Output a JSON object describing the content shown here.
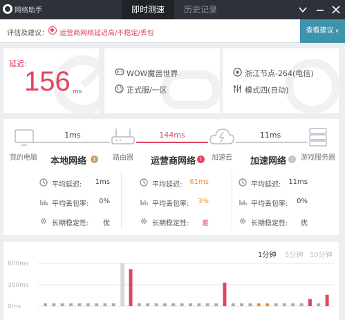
{
  "titlebar": {
    "app_title": "网络助手",
    "tabs": [
      {
        "label": "即时测速",
        "active": true
      },
      {
        "label": "历史记录",
        "active": false
      }
    ],
    "controls": [
      "chevron-down-icon",
      "minimize-icon",
      "close-icon"
    ]
  },
  "advice": {
    "label": "评估及建议：",
    "text": "运营商网络延迟高/不稳定/丢包",
    "button_label": "查看建议",
    "status_color": "#e0465f"
  },
  "latency_card": {
    "label": "延迟:",
    "value": "156",
    "unit": "ms"
  },
  "game_card": {
    "game_name": "WOW魔兽世界",
    "server": "正式服/一区"
  },
  "node_card": {
    "node": "浙江节点-264(电信)",
    "mode": "模式四(自动)"
  },
  "route": {
    "nodes": [
      {
        "label": "我的电脑",
        "icon": "computer-icon"
      },
      {
        "label": "路由器",
        "icon": "router-icon"
      },
      {
        "label": "加速云",
        "icon": "cloud-icon"
      },
      {
        "label": "游戏服务器",
        "icon": "server-icon"
      }
    ],
    "hops": [
      {
        "latency": "1ms",
        "status": "good"
      },
      {
        "latency": "144ms",
        "status": "bad"
      },
      {
        "latency": "11ms",
        "status": "good"
      }
    ],
    "sections": [
      {
        "title": "本地网络",
        "badge_icon": "info-icon",
        "stats": [
          {
            "label": "平均延迟:",
            "value": "1ms",
            "status": "normal"
          },
          {
            "label": "平均丢包率:",
            "value": "0%",
            "status": "normal"
          },
          {
            "label": "长期稳定性:",
            "value": "优",
            "status": "normal"
          }
        ]
      },
      {
        "title": "运营商网络",
        "badge_icon": "alert-icon",
        "stats": [
          {
            "label": "平均延迟:",
            "value": "61ms",
            "status": "warn"
          },
          {
            "label": "平均丢包率:",
            "value": "3%",
            "status": "warn"
          },
          {
            "label": "长期稳定性:",
            "value": "差",
            "status": "bad"
          }
        ]
      },
      {
        "title": "加速网络",
        "badge_icon": "info-icon",
        "stats": [
          {
            "label": "平均延迟:",
            "value": "11ms",
            "status": "normal"
          },
          {
            "label": "平均丢包率:",
            "value": "0%",
            "status": "normal"
          },
          {
            "label": "长期稳定性:",
            "value": "优",
            "status": "normal"
          }
        ]
      }
    ],
    "colors": {
      "good": "#c6cbd2",
      "bad": "#e0465f",
      "warn": "#f08c2e",
      "normal": "#444444"
    }
  },
  "chart": {
    "ranges": [
      {
        "label": "1分钟",
        "active": true
      },
      {
        "label": "5分钟",
        "active": false
      },
      {
        "label": "10分钟",
        "active": false
      }
    ]
  },
  "chart_data": {
    "type": "bar",
    "ylabel": "",
    "y_ticks": [
      "600ms",
      "300ms",
      "0ms"
    ],
    "ylim": [
      0,
      600
    ],
    "grid": true,
    "bars": [
      {
        "value": 40,
        "status": "normal"
      },
      {
        "value": 40,
        "status": "normal"
      },
      {
        "value": 40,
        "status": "normal"
      },
      {
        "value": 40,
        "status": "normal"
      },
      {
        "value": 40,
        "status": "normal"
      },
      {
        "value": 40,
        "status": "normal"
      },
      {
        "value": 40,
        "status": "normal"
      },
      {
        "value": 40,
        "status": "normal"
      },
      {
        "value": 40,
        "status": "normal"
      },
      {
        "value": 600,
        "status": "loss"
      },
      {
        "value": 520,
        "status": "high"
      },
      {
        "value": 40,
        "status": "normal"
      },
      {
        "value": 40,
        "status": "normal"
      },
      {
        "value": 40,
        "status": "normal"
      },
      {
        "value": 40,
        "status": "normal"
      },
      {
        "value": 40,
        "status": "normal"
      },
      {
        "value": 40,
        "status": "normal"
      },
      {
        "value": 40,
        "status": "normal"
      },
      {
        "value": 40,
        "status": "normal"
      },
      {
        "value": 40,
        "status": "normal"
      },
      {
        "value": 40,
        "status": "normal"
      },
      {
        "value": 330,
        "status": "high"
      },
      {
        "value": 40,
        "status": "normal"
      },
      {
        "value": 40,
        "status": "normal"
      },
      {
        "value": 40,
        "status": "normal"
      },
      {
        "value": 40,
        "status": "warn"
      },
      {
        "value": 40,
        "status": "warn"
      },
      {
        "value": 40,
        "status": "normal"
      },
      {
        "value": 40,
        "status": "normal"
      },
      {
        "value": 40,
        "status": "normal"
      },
      {
        "value": 40,
        "status": "normal"
      },
      {
        "value": 100,
        "status": "high"
      },
      {
        "value": 40,
        "status": "normal"
      },
      {
        "value": 160,
        "status": "high"
      }
    ],
    "colors": {
      "normal": "#a9adb3",
      "high": "#e0465f",
      "warn": "#f08c2e",
      "loss": "#d9d9d9"
    }
  }
}
